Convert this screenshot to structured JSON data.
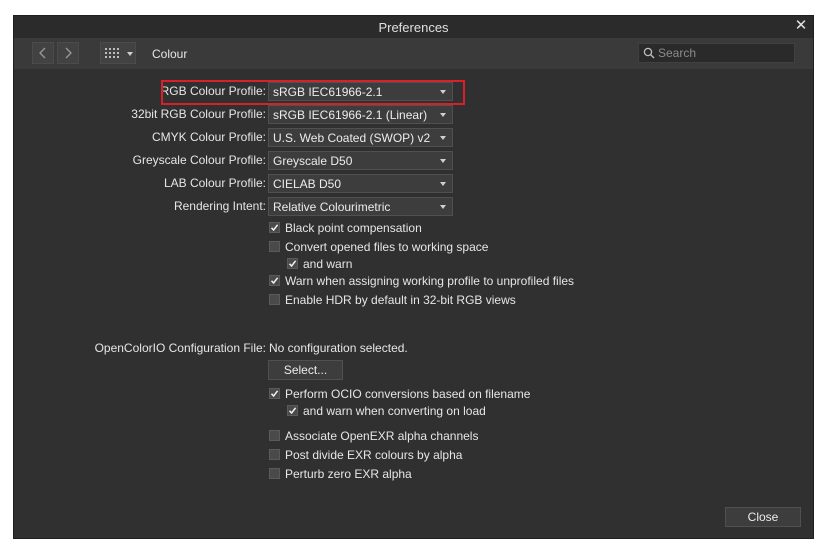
{
  "window": {
    "title": "Preferences"
  },
  "toolbar": {
    "breadcrumb": "Colour",
    "search_placeholder": "Search"
  },
  "profiles": [
    {
      "label": "RGB Colour Profile:",
      "value": "sRGB IEC61966-2.1"
    },
    {
      "label": "32bit RGB Colour Profile:",
      "value": "sRGB IEC61966-2.1 (Linear)"
    },
    {
      "label": "CMYK Colour Profile:",
      "value": "U.S. Web Coated (SWOP) v2"
    },
    {
      "label": "Greyscale Colour Profile:",
      "value": "Greyscale D50"
    },
    {
      "label": "LAB Colour Profile:",
      "value": "CIELAB D50"
    },
    {
      "label": "Rendering Intent:",
      "value": "Relative Colourimetric"
    }
  ],
  "options": [
    {
      "label": "Black point compensation",
      "checked": true
    },
    {
      "label": "Convert opened files to working space",
      "checked": false
    },
    {
      "label": "and warn",
      "checked": true
    },
    {
      "label": "Warn when assigning working profile to unprofiled files",
      "checked": true
    },
    {
      "label": "Enable HDR by default in 32-bit RGB views",
      "checked": false
    }
  ],
  "ocio": {
    "label": "OpenColorIO Configuration File:",
    "value": "No configuration selected.",
    "select_label": "Select..."
  },
  "ocio_options": [
    {
      "label": "Perform OCIO conversions based on filename",
      "checked": true
    },
    {
      "label": "and warn when converting on load",
      "checked": true
    },
    {
      "label": "Associate OpenEXR alpha channels",
      "checked": false
    },
    {
      "label": "Post divide EXR colours by alpha",
      "checked": false
    },
    {
      "label": "Perturb zero EXR alpha",
      "checked": false
    }
  ],
  "footer": {
    "close_label": "Close"
  },
  "colors": {
    "background": "#303030",
    "highlight": "#d9202a"
  }
}
